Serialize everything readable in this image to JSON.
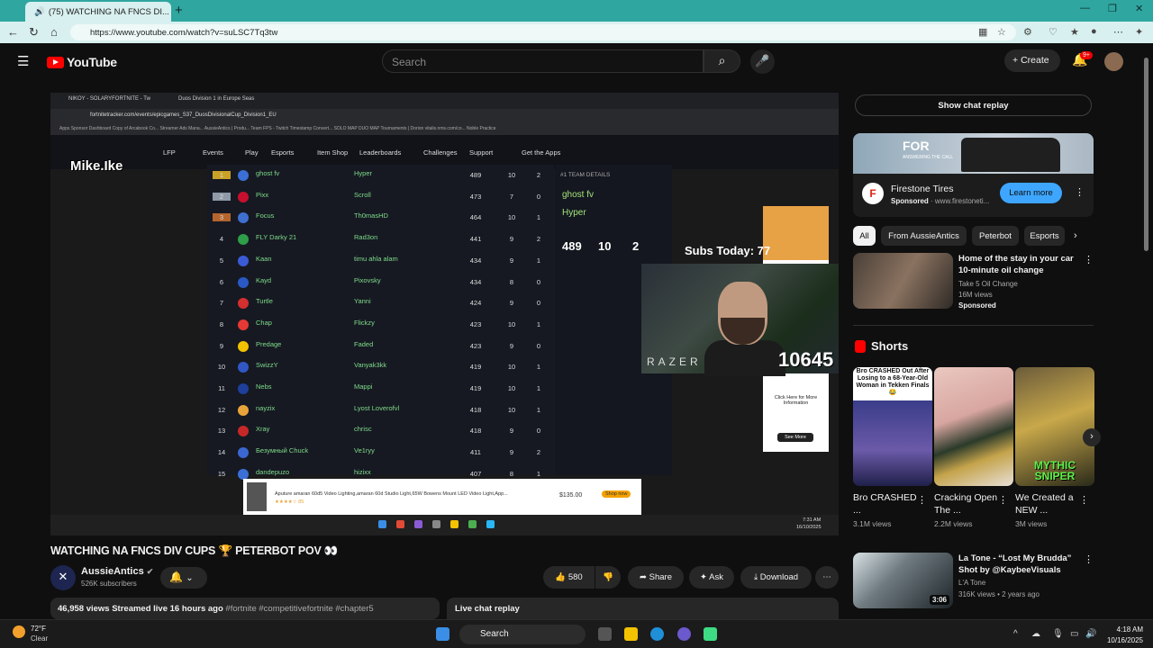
{
  "browser": {
    "tab_title": "(75) WATCHING NA FNCS DI...",
    "url": "https://www.youtube.com/watch?v=suLSC7Tq3tw"
  },
  "header": {
    "logo": "YouTube",
    "search_placeholder": "Search",
    "create_label": "Create",
    "notif_badge": "9+"
  },
  "player": {
    "inner_tab1": "NIKOY - SOLARYFORTNITE - Tw",
    "inner_tab2": "Duos Division 1 in Europe Seas",
    "inner_url": "fortnitetracker.com/events/epicgames_S37_DuosDivisionalCup_Division1_EU",
    "bookmarks": "Apps   Sponsor Dashboard   Copy of Arcabook Co...   Streamer Ads Mana...   AussieAntics | Produ...   Team FPS - Twitch   Timestamp Convert...   SOLO MAP   DUO MAP   Tournaments | Dorion   vitalis.nms.com/co...   Noble Practice",
    "nav": [
      "LFP",
      "Events",
      "Play",
      "Esports",
      "Item Shop",
      "Leaderboards",
      "Challenges",
      "Support",
      "Get the Apps"
    ],
    "overlay_name": "Mike.Ike",
    "rows": [
      {
        "rank": "1",
        "p1": "ghost fv",
        "p2": "Hyper",
        "pts": "489",
        "m": "10",
        "w": "2",
        "flag": "#3b6fd6"
      },
      {
        "rank": "2",
        "p1": "Pixx",
        "p2": "Scroll",
        "pts": "473",
        "m": "7",
        "w": "0",
        "flag": "#c8102e"
      },
      {
        "rank": "3",
        "p1": "Focus",
        "p2": "Th0masHD",
        "pts": "464",
        "m": "10",
        "w": "1",
        "flag": "#3f6fcf"
      },
      {
        "rank": "4",
        "p1": "FLY Darky 21",
        "p2": "Rad3on",
        "pts": "441",
        "m": "9",
        "w": "2",
        "flag": "#2e9e48"
      },
      {
        "rank": "5",
        "p1": "Kaan",
        "p2": "timu ahla alam",
        "pts": "434",
        "m": "9",
        "w": "1",
        "flag": "#3b5bd6"
      },
      {
        "rank": "6",
        "p1": "Kayd",
        "p2": "Pixovsky",
        "pts": "434",
        "m": "8",
        "w": "0",
        "flag": "#2a59c4"
      },
      {
        "rank": "7",
        "p1": "Turtle",
        "p2": "Yanni",
        "pts": "424",
        "m": "9",
        "w": "0",
        "flag": "#d32f2f"
      },
      {
        "rank": "8",
        "p1": "Chap",
        "p2": "Flickzy",
        "pts": "423",
        "m": "10",
        "w": "1",
        "flag": "#e53935"
      },
      {
        "rank": "9",
        "p1": "Predage",
        "p2": "Faded",
        "pts": "423",
        "m": "9",
        "w": "0",
        "flag": "#f2c200"
      },
      {
        "rank": "10",
        "p1": "SwizzY",
        "p2": "Vanyak3kk",
        "pts": "419",
        "m": "10",
        "w": "1",
        "flag": "#3157c4"
      },
      {
        "rank": "11",
        "p1": "Nebs",
        "p2": "Mappi",
        "pts": "419",
        "m": "10",
        "w": "1",
        "flag": "#1e3f9a"
      },
      {
        "rank": "12",
        "p1": "nayzix",
        "p2": "Lyost Loverofvl",
        "pts": "418",
        "m": "10",
        "w": "1",
        "flag": "#e8a33a"
      },
      {
        "rank": "13",
        "p1": "Xray",
        "p2": "chrisc",
        "pts": "418",
        "m": "9",
        "w": "0",
        "flag": "#c62828"
      },
      {
        "rank": "14",
        "p1": "Безумный Chuck",
        "p2": "Ve1ryy",
        "pts": "411",
        "m": "9",
        "w": "2",
        "flag": "#3b67d0"
      },
      {
        "rank": "15",
        "p1": "dandepuzo",
        "p2": "hizixx",
        "pts": "407",
        "m": "8",
        "w": "1",
        "flag": "#3b6fd6"
      }
    ],
    "detail_header": "#1  TEAM DETAILS",
    "detail_p1": "ghost fv",
    "detail_p2": "Hyper",
    "detail_points": "489",
    "detail_matches": "10",
    "detail_wins": "2",
    "subs_text": "Subs Today: 77",
    "counter": "10645",
    "razer": "RAZER",
    "side_ad_text": "Click Here for More Information",
    "side_ad_btn": "See More",
    "banner_text": "Aputure amaran 60d5 Video Lighting,amaran 60d Studio Light,65W Bowens Mount LED Video Light,App...",
    "banner_price": "$135.00",
    "banner_btn": "Shop now",
    "inner_clock": "7:31 AM",
    "inner_date": "16/10/2025"
  },
  "video": {
    "title": "WATCHING NA FNCS DIV CUPS 🏆 PETERBOT POV 👀",
    "channel": "AussieAntics",
    "subscribers": "526K subscribers",
    "likes": "580",
    "share": "Share",
    "ask": "Ask",
    "download": "Download",
    "views": "46,958 views",
    "streamed": "Streamed live 16 hours ago",
    "tags": "#fortnite #competitivefortnite #chapter5",
    "live_chat_replay": "Live chat replay"
  },
  "sidebar": {
    "show_chat": "Show chat replay",
    "ad": {
      "headline": "FOR",
      "subline": "ANSWERING THE CALL",
      "brand": "Firestone Tires",
      "sponsored": "Sponsored",
      "url": "www.firestoneti...",
      "cta": "Learn more"
    },
    "chips": [
      "All",
      "From AussieAntics",
      "Peterbot",
      "Esports"
    ],
    "rec1": {
      "title": "Home of the stay in your car 10-minute oil change",
      "channel": "Take 5 Oil Change",
      "views": "16M views",
      "tag": "Sponsored"
    },
    "shorts_heading": "Shorts",
    "shorts": [
      {
        "title": "Bro CRASHED ...",
        "views": "3.1M views",
        "overlay": "Bro CRASHED Out After Losing to a 68-Year-Old Woman in Tekken Finals 😂"
      },
      {
        "title": "Cracking Open The ...",
        "views": "2.2M views",
        "overlay": ""
      },
      {
        "title": "We Created a NEW ...",
        "views": "3M views",
        "overlay": "MYTHIC SNIPER"
      }
    ],
    "rec2": {
      "title": "La Tone - “Lost My Brudda” Shot by @KaybeeVisuals",
      "channel": "L'A Tone",
      "meta": "316K views • 2 years ago",
      "duration": "3:06"
    }
  },
  "taskbar": {
    "temp": "72°F",
    "weather": "Clear",
    "search": "Search",
    "time": "4:18 AM",
    "date": "10/16/2025"
  }
}
